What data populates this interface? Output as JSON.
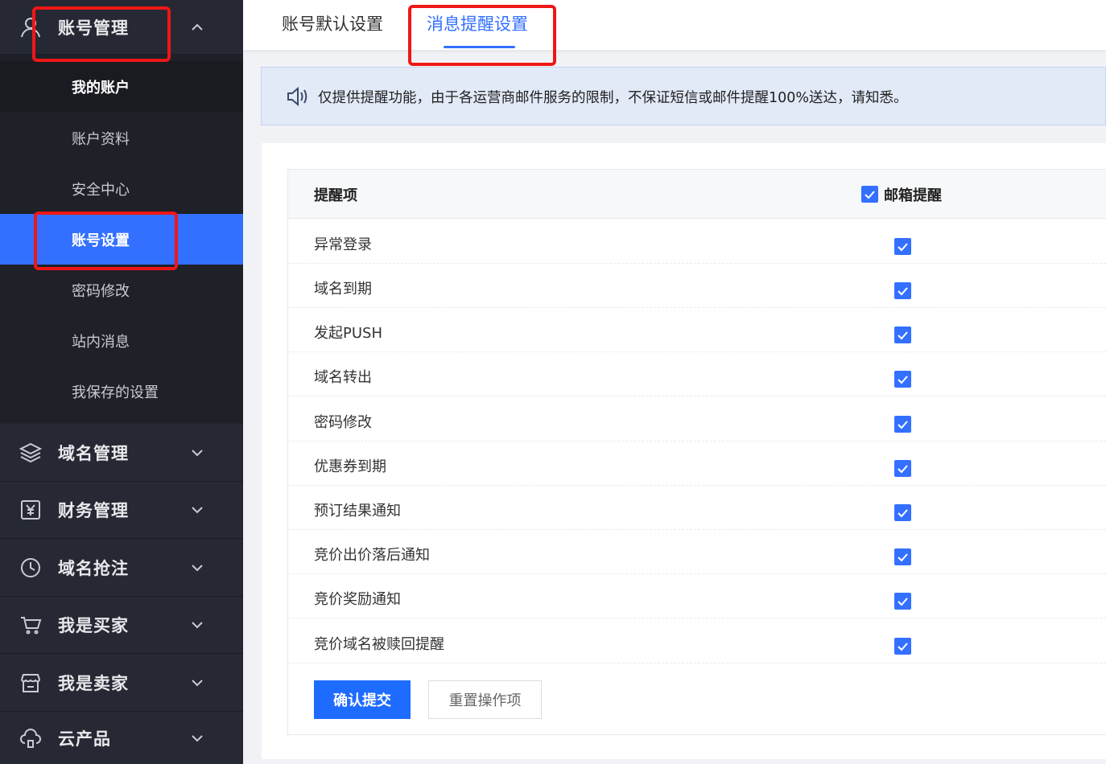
{
  "sidebar": {
    "account_group": "账号管理",
    "account_items": [
      "我的账户",
      "账户资料",
      "安全中心",
      "账号设置",
      "密码修改",
      "站内消息",
      "我保存的设置"
    ],
    "groups": [
      "域名管理",
      "财务管理",
      "域名抢注",
      "我是买家",
      "我是卖家",
      "云产品"
    ]
  },
  "tabs": [
    "账号默认设置",
    "消息提醒设置"
  ],
  "notice": "仅提供提醒功能，由于各运营商邮件服务的限制，不保证短信或邮件提醒100%送达，请知悉。",
  "table": {
    "col_item": "提醒项",
    "col_email": "邮箱提醒",
    "rows": [
      "异常登录",
      "域名到期",
      "发起PUSH",
      "域名转出",
      "密码修改",
      "优惠券到期",
      "预订结果通知",
      "竞价出价落后通知",
      "竞价奖励通知",
      "竞价域名被赎回提醒"
    ]
  },
  "buttons": {
    "submit": "确认提交",
    "reset": "重置操作项"
  },
  "colors": {
    "accent": "#3370ff",
    "sidebar_bg": "#23252e",
    "annotation": "#f01616"
  },
  "icons": [
    "user-icon",
    "layers-icon",
    "finance-icon",
    "clock-icon",
    "cart-icon",
    "store-icon",
    "cloud-icon",
    "speaker-icon",
    "chevron-up-icon",
    "chevron-down-icon",
    "checkbox-checked-icon"
  ]
}
